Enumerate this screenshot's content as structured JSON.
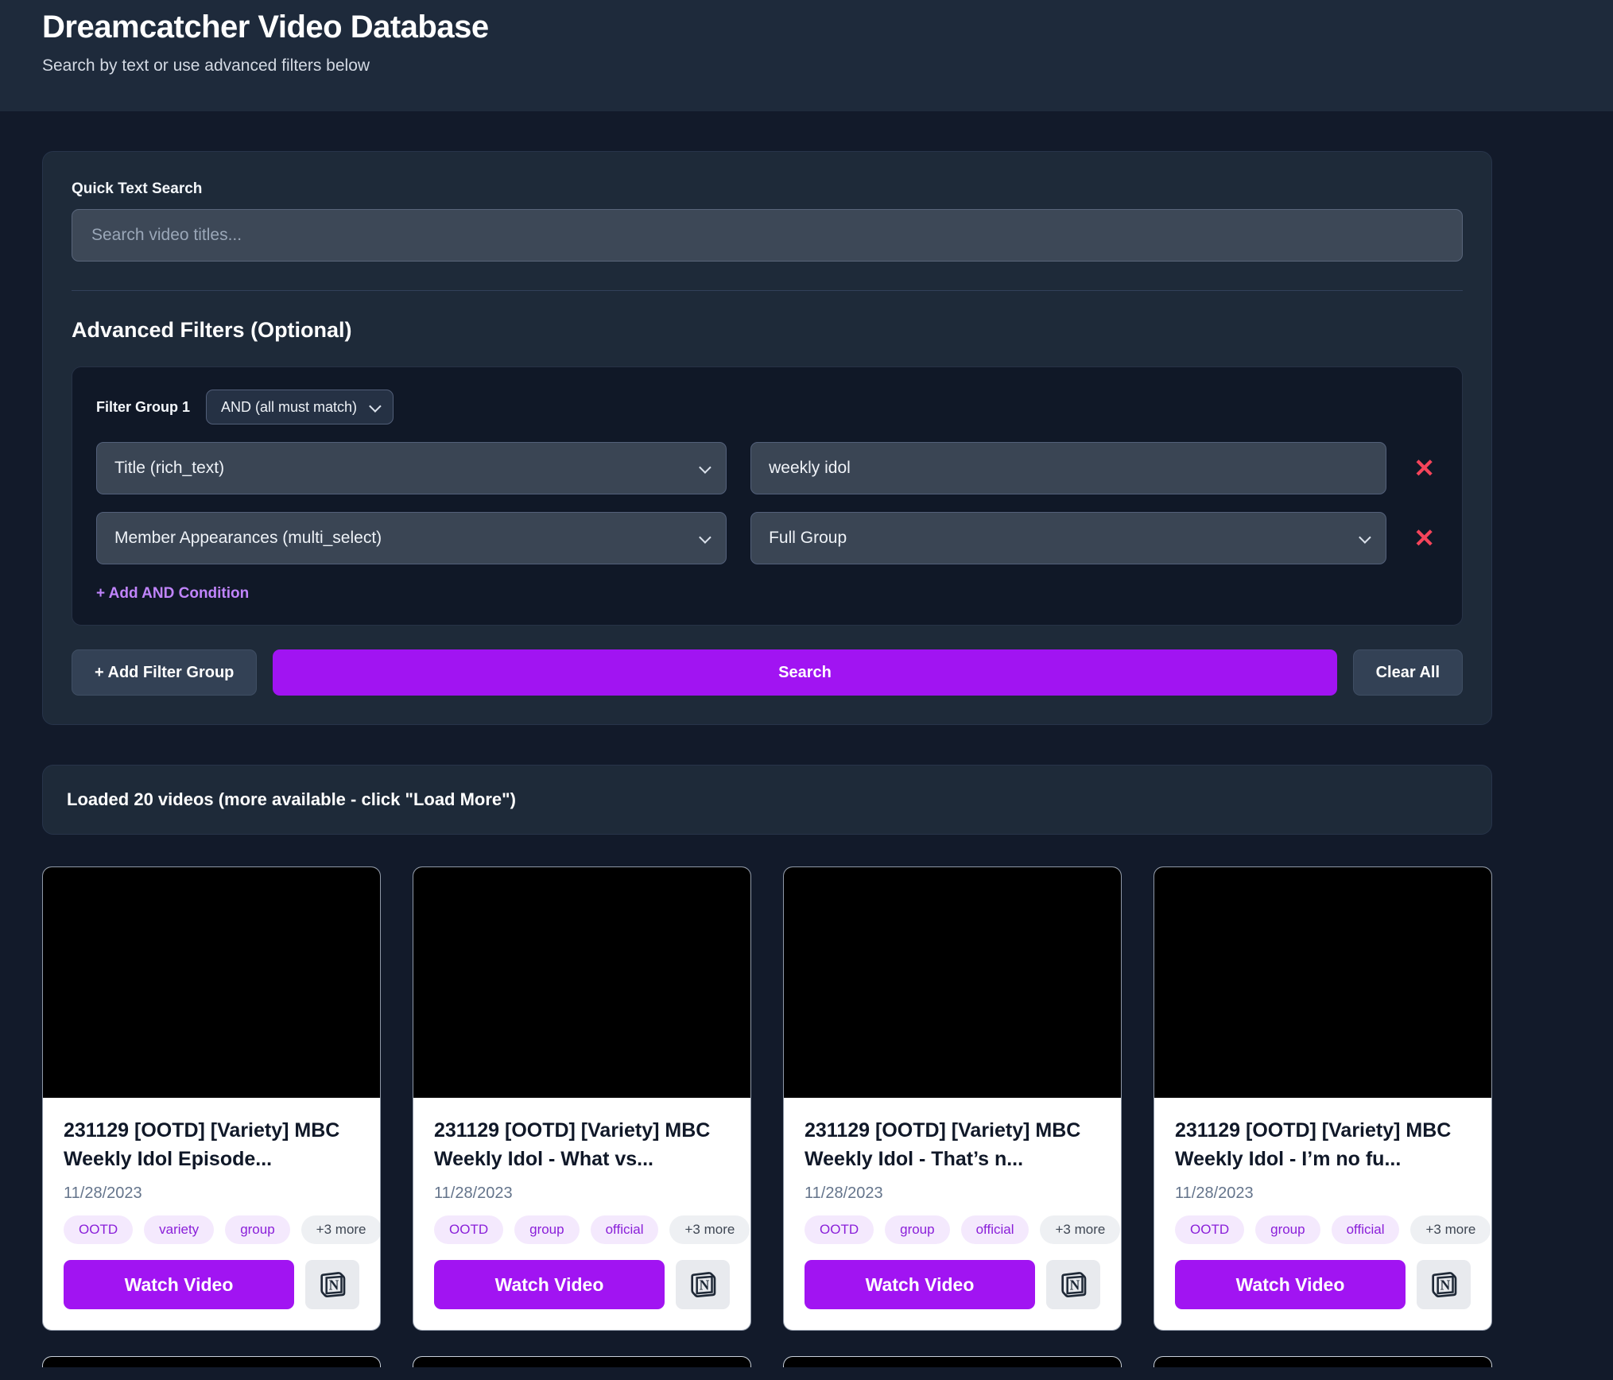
{
  "header": {
    "title": "Dreamcatcher Video Database",
    "subtitle": "Search by text or use advanced filters below"
  },
  "search": {
    "quick_label": "Quick Text Search",
    "placeholder": "Search video titles...",
    "advanced_heading": "Advanced Filters (Optional)",
    "filter_group": {
      "label": "Filter Group 1",
      "match_mode": "AND (all must match)",
      "conditions": [
        {
          "field": "Title (rich_text)",
          "value": "weekly idol"
        },
        {
          "field": "Member Appearances (multi_select)",
          "value": "Full Group"
        }
      ],
      "remove_label": "✕",
      "add_condition_label": "+ Add AND Condition"
    },
    "buttons": {
      "add_group": "+ Add Filter Group",
      "search": "Search",
      "clear": "Clear All"
    }
  },
  "results": {
    "status": "Loaded 20 videos (more available - click \"Load More\")"
  },
  "card_common": {
    "watch_label": "Watch Video"
  },
  "cards": [
    {
      "title": "231129 [OOTD] [Variety] MBC Weekly Idol Episode...",
      "date": "11/28/2023",
      "tags": [
        "OOTD",
        "variety",
        "group"
      ],
      "more": "+3 more"
    },
    {
      "title": "231129 [OOTD] [Variety] MBC Weekly Idol - What vs...",
      "date": "11/28/2023",
      "tags": [
        "OOTD",
        "group",
        "official"
      ],
      "more": "+3 more"
    },
    {
      "title": "231129 [OOTD] [Variety] MBC Weekly Idol - That’s n...",
      "date": "11/28/2023",
      "tags": [
        "OOTD",
        "group",
        "official"
      ],
      "more": "+3 more"
    },
    {
      "title": "231129 [OOTD] [Variety] MBC Weekly Idol - I’m no fu...",
      "date": "11/28/2023",
      "tags": [
        "OOTD",
        "group",
        "official"
      ],
      "more": "+3 more"
    }
  ],
  "colors": {
    "accent_purple": "#a114f2",
    "link_purple": "#c084fc",
    "tag_purple_bg": "#f4e9fd",
    "tag_purple_text": "#8a1fd9",
    "danger_red": "#f4445a",
    "page_bg": "#121a2a",
    "panel_bg": "#1e2a39",
    "header_bg": "#1e2a3b"
  }
}
